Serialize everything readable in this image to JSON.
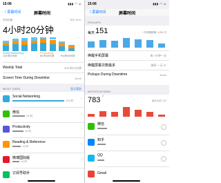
{
  "left": {
    "status_time": "15:06",
    "status_icons": "▮▮▮ ◠ ▭",
    "nav_back": "〈 屏幕时间",
    "nav_title": "屏幕时间",
    "device": "所有设备",
    "date": "今天 15:01",
    "total_time": "4小时20分钟",
    "legend": [
      {
        "label": "Social Networking",
        "time": "13小时2分钟"
      },
      {
        "label": "Productivity",
        "time": "8小时18分钟"
      },
      {
        "label": "",
        "time": "9小时44分钟"
      }
    ],
    "weekly_total_label": "Weekly Total",
    "weekly_total_value": "30小时20分钟",
    "downtime_label": "Screen Time During Downtime",
    "downtime_value": "None",
    "most_used_header": "MOST USED",
    "most_used_toggle": "显示类别",
    "apps": [
      {
        "name": "Social Networking",
        "time": "12小时",
        "color": "#34aadc"
      },
      {
        "name": "微信",
        "time": "2小时",
        "color": "#2dc100"
      },
      {
        "name": "Productivity",
        "time": "2小时",
        "color": "#5856d6"
      },
      {
        "name": "Reading & Reference",
        "time": "1小时",
        "color": "#ff9500"
      },
      {
        "name": "微博国际版",
        "time": "1小时",
        "color": "#e6162d"
      },
      {
        "name": "订阅号助手",
        "time": "",
        "color": "#07c160"
      }
    ]
  },
  "right": {
    "status_time": "15:06",
    "status_icons": "▮▮▮ ◠ ▭",
    "nav_back": "〈 屏幕时间",
    "nav_title": "屏幕时间",
    "pickups_header": "PICKUPS",
    "pickups_prefix": "每天",
    "pickups_value": "151",
    "pickups_total": "一共唤醒屏幕 1,056 次",
    "pickups_values": [
      60,
      75,
      70,
      95,
      80,
      72,
      40
    ],
    "wake_label": "唤醒手机屏幕",
    "wake_value": "每 7分钟一次",
    "most_wake_label": "唤醒屏幕次数最多",
    "most_wake_value": "周四 一天 57",
    "pickups_downtime_label": "Pickups During Downtime",
    "pickups_downtime_value": "None",
    "notifications_header": "NOTIFICATIONS",
    "notif_value": "783",
    "notif_suffix": "每天大约 112",
    "notif_values": [
      30,
      55,
      45,
      95,
      65,
      50,
      20
    ],
    "notif_apps": [
      {
        "name": "微信",
        "time": "",
        "color": "#2dc100"
      },
      {
        "name": "知乎",
        "time": "",
        "color": "#0084ff"
      },
      {
        "name": "QQ",
        "time": "",
        "color": "#12b7f5"
      },
      {
        "name": "Gmail",
        "time": "",
        "color": "#ea4335"
      }
    ]
  },
  "colors": {
    "accent": "#0a7aff",
    "social": "#34aadc",
    "productivity": "#ff9500",
    "other": "#5ac8fa",
    "pickups": "#4aa8e8",
    "notif": "#e84a3a"
  }
}
